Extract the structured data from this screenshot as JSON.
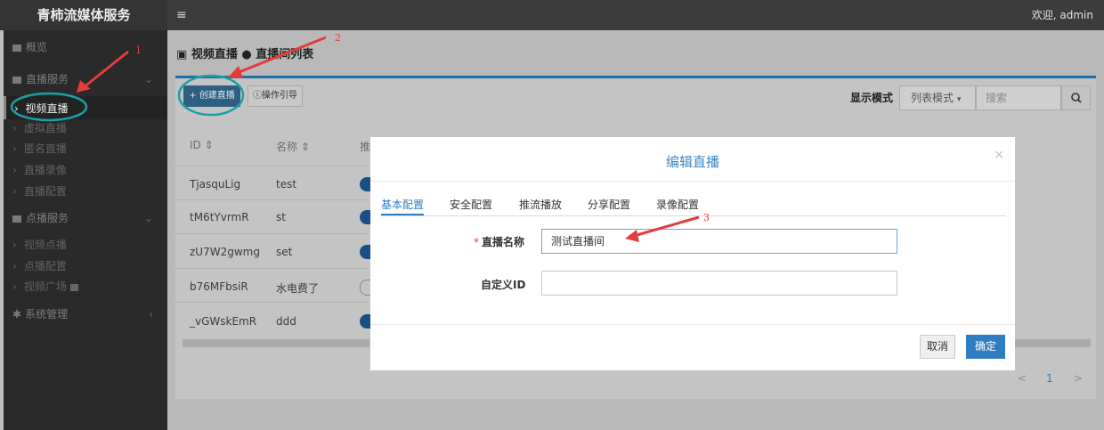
{
  "topbar": {
    "brand": "青柿流媒体服务",
    "menu_icon": "≡",
    "welcome": "欢迎, admin"
  },
  "sidebar": {
    "overview": "概览",
    "live_group": "直播服务",
    "live_items": [
      "视频直播",
      "虚拟直播",
      "匿名直播",
      "直播录像",
      "直播配置"
    ],
    "vod_group": "点播服务",
    "vod_items": [
      "视频点播",
      "点播配置",
      "视频广场"
    ],
    "system_group": "系统管理"
  },
  "breadcrumb": {
    "section": "视频直播",
    "sep": "●",
    "page": "直播间列表"
  },
  "toolbar": {
    "create_label": "+ 创建直播",
    "guide_label": "操作引导",
    "display_mode_label": "显示模式",
    "display_mode_value": "列表模式",
    "search_placeholder": "搜索"
  },
  "table": {
    "headers": [
      "ID ⇕",
      "名称 ⇕",
      "推"
    ],
    "rows": [
      {
        "id": "TjasquLig",
        "name": "test",
        "toggle_on": true
      },
      {
        "id": "tM6tYvrmR",
        "name": "st",
        "toggle_on": true
      },
      {
        "id": "zU7W2gwmg",
        "name": "set",
        "toggle_on": true
      },
      {
        "id": "b76MFbsiR",
        "name": "水电费了",
        "toggle_on": false
      },
      {
        "id": "_vGWskEmR",
        "name": "ddd",
        "toggle_on": true
      }
    ]
  },
  "pagination": {
    "prev": "<",
    "current": "1",
    "next": ">"
  },
  "dialog": {
    "title": "编辑直播",
    "close": "×",
    "tabs": [
      "基本配置",
      "安全配置",
      "推流播放",
      "分享配置",
      "录像配置"
    ],
    "active_tab": 0,
    "fields": {
      "name_label": "直播名称",
      "name_required": "*",
      "name_value": "测试直播间",
      "custom_id_label": "自定义ID",
      "custom_id_value": ""
    },
    "cancel_label": "取消",
    "ok_label": "确定"
  },
  "annotations": {
    "numbers": [
      "1",
      "2",
      "3"
    ],
    "color": "#e23c3c"
  },
  "colors": {
    "primary": "#2f7ec2",
    "annotation": "#e23c3c",
    "sidebar": "#2a2a2a",
    "topbar": "#3c3c3c"
  }
}
